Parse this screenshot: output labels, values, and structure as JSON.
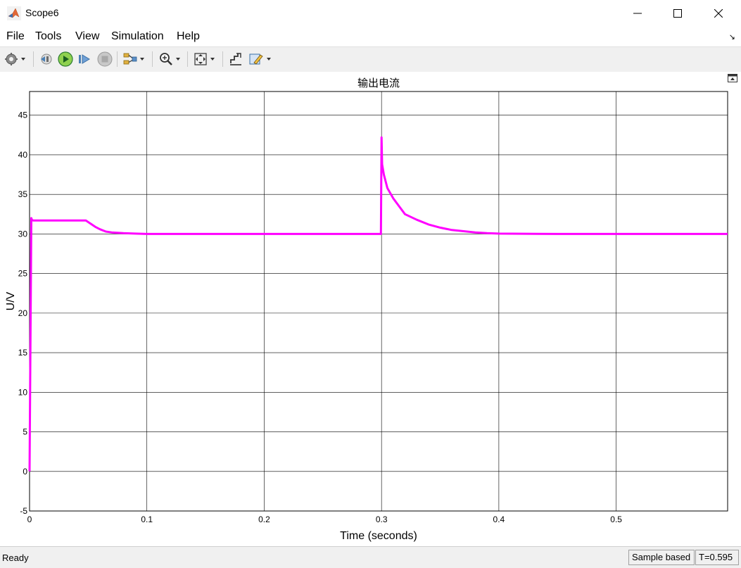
{
  "window": {
    "title": "Scope6"
  },
  "menu": {
    "items": [
      "File",
      "Tools",
      "View",
      "Simulation",
      "Help"
    ]
  },
  "toolbar": {
    "icons": [
      "gear-icon",
      "step-back-icon",
      "run-icon",
      "step-forward-icon",
      "stop-icon",
      "signal-select-icon",
      "zoom-icon",
      "autoscale-icon",
      "cursor-icon",
      "highlight-icon"
    ]
  },
  "chart_data": {
    "type": "line",
    "title": "输出电流",
    "xlabel": "Time (seconds)",
    "ylabel": "U/V",
    "xlim": [
      0,
      0.595
    ],
    "ylim": [
      -5,
      48
    ],
    "xticks": [
      0,
      0.1,
      0.2,
      0.3,
      0.4,
      0.5
    ],
    "xtick_labels": [
      "0",
      "0.1",
      "0.2",
      "0.3",
      "0.4",
      "0.5"
    ],
    "yticks": [
      -5,
      0,
      5,
      10,
      15,
      20,
      25,
      30,
      35,
      40,
      45
    ],
    "ytick_labels": [
      "-5",
      "0",
      "5",
      "10",
      "15",
      "20",
      "25",
      "30",
      "35",
      "40",
      "45"
    ],
    "grid": true,
    "background": "#ffffff",
    "series": [
      {
        "color": "#ff00ff",
        "x": [
          0,
          0.0015,
          0.002,
          0.003,
          0.005,
          0.02,
          0.035,
          0.048,
          0.052,
          0.056,
          0.06,
          0.065,
          0.07,
          0.08,
          0.09,
          0.1,
          0.15,
          0.2,
          0.25,
          0.2995,
          0.3,
          0.3005,
          0.302,
          0.305,
          0.31,
          0.315,
          0.32,
          0.33,
          0.34,
          0.35,
          0.36,
          0.37,
          0.38,
          0.39,
          0.4,
          0.45,
          0.5,
          0.55,
          0.595
        ],
        "y": [
          0,
          32,
          31.8,
          31.7,
          31.7,
          31.7,
          31.7,
          31.7,
          31.3,
          30.9,
          30.6,
          30.3,
          30.2,
          30.1,
          30.05,
          30.0,
          30.0,
          30.0,
          30.0,
          30.0,
          42.2,
          38.8,
          37.5,
          35.8,
          34.5,
          33.5,
          32.5,
          31.8,
          31.2,
          30.8,
          30.5,
          30.35,
          30.2,
          30.1,
          30.05,
          30.0,
          30.0,
          30.0,
          30.0
        ]
      }
    ]
  },
  "status": {
    "text": "Ready",
    "mode": "Sample based",
    "time": "T=0.595"
  }
}
